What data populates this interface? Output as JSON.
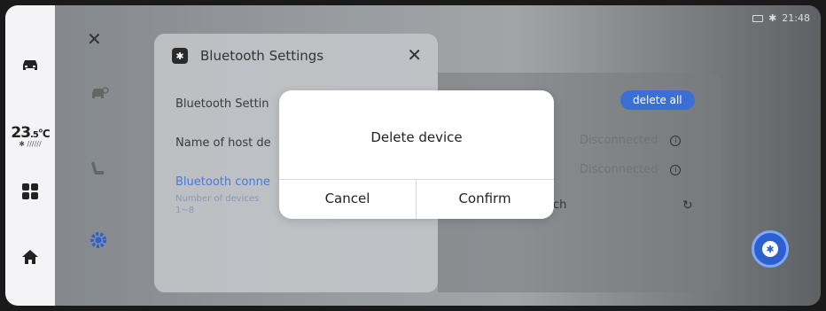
{
  "status_bar": {
    "time": "21:48"
  },
  "climate": {
    "temp_main": "23",
    "temp_sub": ".5",
    "temp_unit": "°C"
  },
  "settings_panel": {
    "title": "Bluetooth Settings",
    "rows": {
      "bluetooth_setting": "Bluetooth Settin",
      "host_name": "Name of host de",
      "connections": "Bluetooth conne",
      "devices_note": "Number of devices",
      "devices_range": "1~8"
    }
  },
  "devices": {
    "delete_all": "delete all",
    "status_1": "Disconnected",
    "status_2": "Disconnected",
    "partial_text": "ch"
  },
  "dialog": {
    "title": "Delete device",
    "cancel": "Cancel",
    "confirm": "Confirm"
  },
  "colors": {
    "accent": "#3b6fd6",
    "dialog_bg": "#ffffff"
  }
}
